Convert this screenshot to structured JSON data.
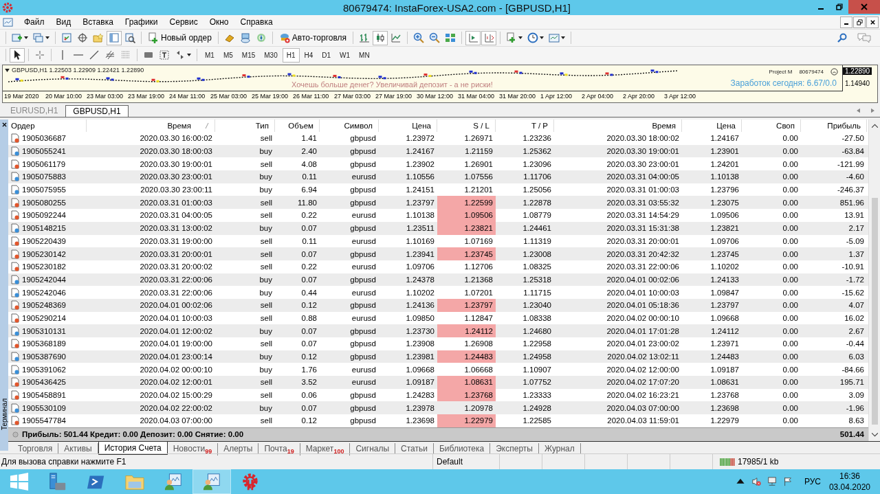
{
  "window": {
    "title": "80679474: InstaForex-USA2.com - [GBPUSD,H1]"
  },
  "menu": [
    "Файл",
    "Вид",
    "Вставка",
    "Графики",
    "Сервис",
    "Окно",
    "Справка"
  ],
  "toolbar": {
    "new_order": "Новый ордер",
    "auto_trading": "Авто-торговля",
    "terminal_pressed": true,
    "bar_chart_pressed": false,
    "candles_pressed": true,
    "line_chart_pressed": false,
    "autoscroll_pressed": true,
    "chart_shift_pressed": true
  },
  "drawing_toolbar": {
    "cursor_pressed": true,
    "timeframes": [
      {
        "label": "M1",
        "selected": false
      },
      {
        "label": "M5",
        "selected": false
      },
      {
        "label": "M15",
        "selected": false
      },
      {
        "label": "M30",
        "selected": false
      },
      {
        "label": "H1",
        "selected": true
      },
      {
        "label": "H4",
        "selected": false
      },
      {
        "label": "D1",
        "selected": false
      },
      {
        "label": "W1",
        "selected": false
      },
      {
        "label": "MN",
        "selected": false
      }
    ]
  },
  "chart": {
    "ohlc": "GBPUSD,H1  1.22503 1.22909 1.22421 1.22890",
    "expert": "Project M",
    "account": "80679474",
    "earnings": "Заработок сегодня: 6.67/0.0",
    "banner": "Хочешь больше денег? Увеличивай депозит - а не риски!",
    "bid_price": "1.22890",
    "low_price": "1.14940",
    "dates": [
      "19 Mar 2020",
      "20 Mar 10:00",
      "23 Mar 03:00",
      "23 Mar 19:00",
      "24 Mar 11:00",
      "25 Mar 03:00",
      "25 Mar 19:00",
      "26 Mar 11:00",
      "27 Mar 03:00",
      "27 Mar 19:00",
      "30 Mar 12:00",
      "31 Mar 04:00",
      "31 Mar 20:00",
      "1 Apr 12:00",
      "2 Apr 04:00",
      "2 Apr 20:00",
      "3 Apr 12:00"
    ]
  },
  "chart_tabs": [
    {
      "label": "EURUSD,H1",
      "selected": false
    },
    {
      "label": "GBPUSD,H1",
      "selected": true
    }
  ],
  "terminal": {
    "side_label": "Терминал",
    "columns": [
      "Ордер",
      "Время",
      "Тип",
      "Объем",
      "Символ",
      "Цена",
      "S / L",
      "T / P",
      "Время",
      "Цена",
      "Своп",
      "Прибыль"
    ],
    "rows": [
      {
        "kind": "sell",
        "order": "1905036687",
        "time": "2020.03.30 16:00:02",
        "type": "sell",
        "volume": "1.41",
        "symbol": "gbpusd",
        "price": "1.23972",
        "sl": "1.26971",
        "sl_hit": false,
        "tp": "1.23236",
        "close_time": "2020.03.30 18:00:02",
        "close_price": "1.24167",
        "swap": "0.00",
        "profit": "-27.50"
      },
      {
        "kind": "buy",
        "order": "1905055241",
        "time": "2020.03.30 18:00:03",
        "type": "buy",
        "volume": "2.40",
        "symbol": "gbpusd",
        "price": "1.24167",
        "sl": "1.21159",
        "sl_hit": false,
        "tp": "1.25362",
        "close_time": "2020.03.30 19:00:01",
        "close_price": "1.23901",
        "swap": "0.00",
        "profit": "-63.84"
      },
      {
        "kind": "sell",
        "order": "1905061179",
        "time": "2020.03.30 19:00:01",
        "type": "sell",
        "volume": "4.08",
        "symbol": "gbpusd",
        "price": "1.23902",
        "sl": "1.26901",
        "sl_hit": false,
        "tp": "1.23096",
        "close_time": "2020.03.30 23:00:01",
        "close_price": "1.24201",
        "swap": "0.00",
        "profit": "-121.99"
      },
      {
        "kind": "buy",
        "order": "1905075883",
        "time": "2020.03.30 23:00:01",
        "type": "buy",
        "volume": "0.11",
        "symbol": "eurusd",
        "price": "1.10556",
        "sl": "1.07556",
        "sl_hit": false,
        "tp": "1.11706",
        "close_time": "2020.03.31 04:00:05",
        "close_price": "1.10138",
        "swap": "0.00",
        "profit": "-4.60"
      },
      {
        "kind": "buy",
        "order": "1905075955",
        "time": "2020.03.30 23:00:11",
        "type": "buy",
        "volume": "6.94",
        "symbol": "gbpusd",
        "price": "1.24151",
        "sl": "1.21201",
        "sl_hit": false,
        "tp": "1.25056",
        "close_time": "2020.03.31 01:00:03",
        "close_price": "1.23796",
        "swap": "0.00",
        "profit": "-246.37"
      },
      {
        "kind": "sell",
        "order": "1905080255",
        "time": "2020.03.31 01:00:03",
        "type": "sell",
        "volume": "11.80",
        "symbol": "gbpusd",
        "price": "1.23797",
        "sl": "1.22599",
        "sl_hit": true,
        "tp": "1.22878",
        "close_time": "2020.03.31 03:55:32",
        "close_price": "1.23075",
        "swap": "0.00",
        "profit": "851.96"
      },
      {
        "kind": "sell",
        "order": "1905092244",
        "time": "2020.03.31 04:00:05",
        "type": "sell",
        "volume": "0.22",
        "symbol": "eurusd",
        "price": "1.10138",
        "sl": "1.09506",
        "sl_hit": true,
        "tp": "1.08779",
        "close_time": "2020.03.31 14:54:29",
        "close_price": "1.09506",
        "swap": "0.00",
        "profit": "13.91"
      },
      {
        "kind": "buy",
        "order": "1905148215",
        "time": "2020.03.31 13:00:02",
        "type": "buy",
        "volume": "0.07",
        "symbol": "gbpusd",
        "price": "1.23511",
        "sl": "1.23821",
        "sl_hit": true,
        "tp": "1.24461",
        "close_time": "2020.03.31 15:31:38",
        "close_price": "1.23821",
        "swap": "0.00",
        "profit": "2.17"
      },
      {
        "kind": "sell",
        "order": "1905220439",
        "time": "2020.03.31 19:00:00",
        "type": "sell",
        "volume": "0.11",
        "symbol": "eurusd",
        "price": "1.10169",
        "sl": "1.07169",
        "sl_hit": false,
        "tp": "1.11319",
        "close_time": "2020.03.31 20:00:01",
        "close_price": "1.09706",
        "swap": "0.00",
        "profit": "-5.09"
      },
      {
        "kind": "sell",
        "order": "1905230142",
        "time": "2020.03.31 20:00:01",
        "type": "sell",
        "volume": "0.07",
        "symbol": "gbpusd",
        "price": "1.23941",
        "sl": "1.23745",
        "sl_hit": true,
        "tp": "1.23008",
        "close_time": "2020.03.31 20:42:32",
        "close_price": "1.23745",
        "swap": "0.00",
        "profit": "1.37"
      },
      {
        "kind": "sell",
        "order": "1905230182",
        "time": "2020.03.31 20:00:02",
        "type": "sell",
        "volume": "0.22",
        "symbol": "eurusd",
        "price": "1.09706",
        "sl": "1.12706",
        "sl_hit": false,
        "tp": "1.08325",
        "close_time": "2020.03.31 22:00:06",
        "close_price": "1.10202",
        "swap": "0.00",
        "profit": "-10.91"
      },
      {
        "kind": "buy",
        "order": "1905242044",
        "time": "2020.03.31 22:00:06",
        "type": "buy",
        "volume": "0.07",
        "symbol": "gbpusd",
        "price": "1.24378",
        "sl": "1.21368",
        "sl_hit": false,
        "tp": "1.25318",
        "close_time": "2020.04.01 00:02:06",
        "close_price": "1.24133",
        "swap": "0.00",
        "profit": "-1.72"
      },
      {
        "kind": "buy",
        "order": "1905242046",
        "time": "2020.03.31 22:00:06",
        "type": "buy",
        "volume": "0.44",
        "symbol": "eurusd",
        "price": "1.10202",
        "sl": "1.07201",
        "sl_hit": false,
        "tp": "1.11715",
        "close_time": "2020.04.01 10:00:03",
        "close_price": "1.09847",
        "swap": "0.00",
        "profit": "-15.62"
      },
      {
        "kind": "sell",
        "order": "1905248369",
        "time": "2020.04.01 00:02:06",
        "type": "sell",
        "volume": "0.12",
        "symbol": "gbpusd",
        "price": "1.24136",
        "sl": "1.23797",
        "sl_hit": true,
        "tp": "1.23040",
        "close_time": "2020.04.01 05:18:36",
        "close_price": "1.23797",
        "swap": "0.00",
        "profit": "4.07"
      },
      {
        "kind": "sell",
        "order": "1905290214",
        "time": "2020.04.01 10:00:03",
        "type": "sell",
        "volume": "0.88",
        "symbol": "eurusd",
        "price": "1.09850",
        "sl": "1.12847",
        "sl_hit": false,
        "tp": "1.08338",
        "close_time": "2020.04.02 00:00:10",
        "close_price": "1.09668",
        "swap": "0.00",
        "profit": "16.02"
      },
      {
        "kind": "buy",
        "order": "1905310131",
        "time": "2020.04.01 12:00:02",
        "type": "buy",
        "volume": "0.07",
        "symbol": "gbpusd",
        "price": "1.23730",
        "sl": "1.24112",
        "sl_hit": true,
        "tp": "1.24680",
        "close_time": "2020.04.01 17:01:28",
        "close_price": "1.24112",
        "swap": "0.00",
        "profit": "2.67"
      },
      {
        "kind": "sell",
        "order": "1905368189",
        "time": "2020.04.01 19:00:00",
        "type": "sell",
        "volume": "0.07",
        "symbol": "gbpusd",
        "price": "1.23908",
        "sl": "1.26908",
        "sl_hit": false,
        "tp": "1.22958",
        "close_time": "2020.04.01 23:00:02",
        "close_price": "1.23971",
        "swap": "0.00",
        "profit": "-0.44"
      },
      {
        "kind": "buy",
        "order": "1905387690",
        "time": "2020.04.01 23:00:14",
        "type": "buy",
        "volume": "0.12",
        "symbol": "gbpusd",
        "price": "1.23981",
        "sl": "1.24483",
        "sl_hit": true,
        "tp": "1.24958",
        "close_time": "2020.04.02 13:02:11",
        "close_price": "1.24483",
        "swap": "0.00",
        "profit": "6.03"
      },
      {
        "kind": "buy",
        "order": "1905391062",
        "time": "2020.04.02 00:00:10",
        "type": "buy",
        "volume": "1.76",
        "symbol": "eurusd",
        "price": "1.09668",
        "sl": "1.06668",
        "sl_hit": false,
        "tp": "1.10907",
        "close_time": "2020.04.02 12:00:00",
        "close_price": "1.09187",
        "swap": "0.00",
        "profit": "-84.66"
      },
      {
        "kind": "sell",
        "order": "1905436425",
        "time": "2020.04.02 12:00:01",
        "type": "sell",
        "volume": "3.52",
        "symbol": "eurusd",
        "price": "1.09187",
        "sl": "1.08631",
        "sl_hit": true,
        "tp": "1.07752",
        "close_time": "2020.04.02 17:07:20",
        "close_price": "1.08631",
        "swap": "0.00",
        "profit": "195.71"
      },
      {
        "kind": "sell",
        "order": "1905458891",
        "time": "2020.04.02 15:00:29",
        "type": "sell",
        "volume": "0.06",
        "symbol": "gbpusd",
        "price": "1.24283",
        "sl": "1.23768",
        "sl_hit": true,
        "tp": "1.23333",
        "close_time": "2020.04.02 16:23:21",
        "close_price": "1.23768",
        "swap": "0.00",
        "profit": "3.09"
      },
      {
        "kind": "buy",
        "order": "1905530109",
        "time": "2020.04.02 22:00:02",
        "type": "buy",
        "volume": "0.07",
        "symbol": "gbpusd",
        "price": "1.23978",
        "sl": "1.20978",
        "sl_hit": false,
        "tp": "1.24928",
        "close_time": "2020.04.03 07:00:00",
        "close_price": "1.23698",
        "swap": "0.00",
        "profit": "-1.96"
      },
      {
        "kind": "sell",
        "order": "1905547784",
        "time": "2020.04.03 07:00:00",
        "type": "sell",
        "volume": "0.12",
        "symbol": "gbpusd",
        "price": "1.23698",
        "sl": "1.22979",
        "sl_hit": true,
        "tp": "1.22585",
        "close_time": "2020.04.03 11:59:01",
        "close_price": "1.22979",
        "swap": "0.00",
        "profit": "8.63"
      }
    ],
    "summary": "Прибыль: 501.44  Кредит: 0.00  Депозит: 0.00  Снятие: 0.00",
    "total": "501.44",
    "tabs": [
      {
        "label": "Торговля",
        "selected": false
      },
      {
        "label": "Активы",
        "selected": false
      },
      {
        "label": "История Счета",
        "selected": true
      },
      {
        "label": "Новости",
        "count": "99",
        "selected": false
      },
      {
        "label": "Алерты",
        "selected": false
      },
      {
        "label": "Почта",
        "count": "19",
        "selected": false
      },
      {
        "label": "Маркет",
        "count": "100",
        "selected": false
      },
      {
        "label": "Сигналы",
        "selected": false
      },
      {
        "label": "Статьи",
        "selected": false
      },
      {
        "label": "Библиотека",
        "selected": false
      },
      {
        "label": "Эксперты",
        "selected": false
      },
      {
        "label": "Журнал",
        "selected": false
      }
    ]
  },
  "status_bar": {
    "help": "Для вызова справки нажмите F1",
    "profile": "Default",
    "traffic": "17985/1 kb"
  },
  "taskbar": {
    "apps": [
      {
        "kind": "start",
        "active": false
      },
      {
        "kind": "server",
        "active": false
      },
      {
        "kind": "shell",
        "active": false
      },
      {
        "kind": "folder",
        "active": false
      },
      {
        "kind": "terminal",
        "active": false
      },
      {
        "kind": "terminal",
        "active": true
      },
      {
        "kind": "gear",
        "active": false
      }
    ],
    "language": "РУС",
    "time": "16:36",
    "date": "03.04.2020"
  }
}
